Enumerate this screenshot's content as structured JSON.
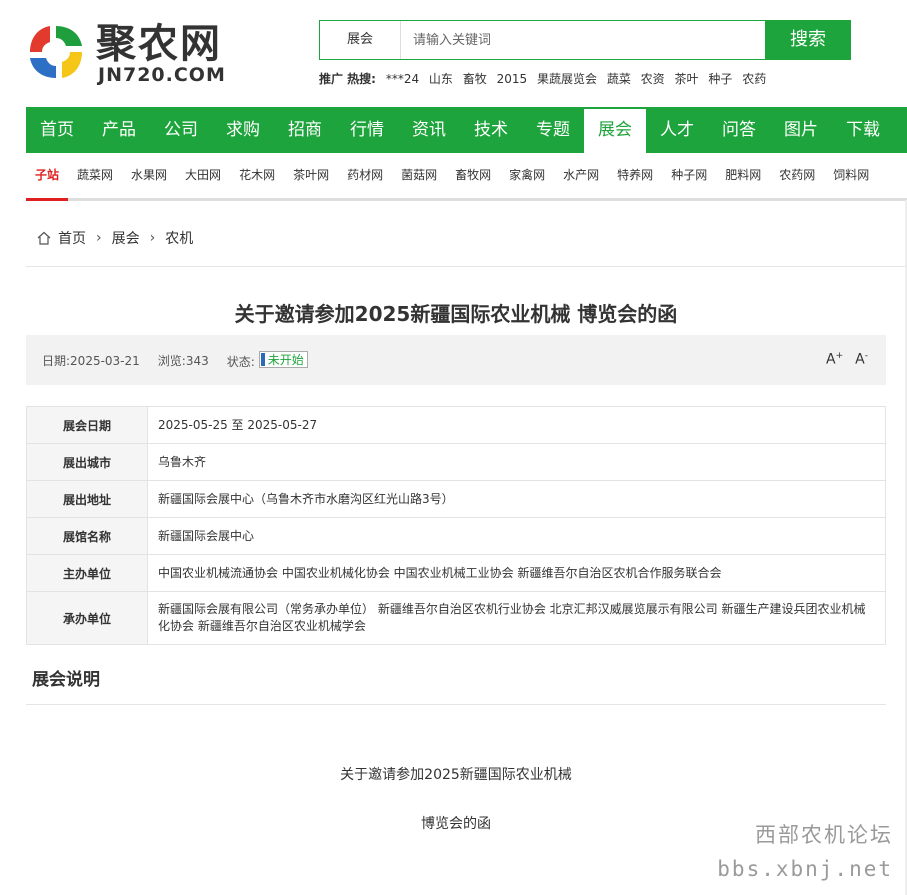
{
  "logo": {
    "name_cn": "聚农网",
    "name_en": "JN720.COM"
  },
  "search": {
    "category": "展会",
    "placeholder": "请输入关键词",
    "button": "搜索"
  },
  "hot": {
    "label": "推广 热搜:",
    "terms": [
      "***24",
      "山东",
      "畜牧",
      "2015",
      "果蔬展览会",
      "蔬菜",
      "农资",
      "茶叶",
      "种子",
      "农药"
    ]
  },
  "nav": {
    "items": [
      "首页",
      "产品",
      "公司",
      "求购",
      "招商",
      "行情",
      "资讯",
      "技术",
      "专题",
      "展会",
      "人才",
      "问答",
      "图片",
      "下载"
    ],
    "active": "展会"
  },
  "subnav": {
    "items": [
      "子站",
      "蔬菜网",
      "水果网",
      "大田网",
      "花木网",
      "茶叶网",
      "药材网",
      "菌菇网",
      "畜牧网",
      "家禽网",
      "水产网",
      "特养网",
      "种子网",
      "肥料网",
      "农药网",
      "饲料网"
    ],
    "active": "子站"
  },
  "breadcrumb": {
    "home": "首页",
    "level1": "展会",
    "level2": "农机"
  },
  "article": {
    "title": "关于邀请参加2025新疆国际农业机械 博览会的函",
    "date_label": "日期:",
    "date": "2025-03-21",
    "views_label": "浏览:",
    "views": "343",
    "status_label": "状态:",
    "status": "未开始",
    "font_up": "A",
    "font_down": "A",
    "font_up_sign": "+",
    "font_down_sign": "-"
  },
  "info_table": [
    {
      "key": "展会日期",
      "value": "2025-05-25 至 2025-05-27"
    },
    {
      "key": "展出城市",
      "value": "乌鲁木齐"
    },
    {
      "key": "展出地址",
      "value": "新疆国际会展中心（乌鲁木齐市水磨沟区红光山路3号）"
    },
    {
      "key": "展馆名称",
      "value": "新疆国际会展中心"
    },
    {
      "key": "主办单位",
      "value": "中国农业机械流通协会 中国农业机械化协会 中国农业机械工业协会 新疆维吾尔自治区农机合作服务联合会"
    },
    {
      "key": "承办单位",
      "value": "新疆国际会展有限公司（常务承办单位） 新疆维吾尔自治区农机行业协会 北京汇邦汉威展览展示有限公司 新疆生产建设兵团农业机械化协会 新疆维吾尔自治区农业机械学会"
    }
  ],
  "section": {
    "title": "展会说明"
  },
  "body": {
    "line1": "关于邀请参加2025新疆国际农业机械",
    "line2": "博览会的函"
  },
  "watermark": {
    "line1": "西部农机论坛",
    "line2": "bbs.xbnj.net"
  },
  "colors": {
    "brand_green": "#1ea43c",
    "active_red": "#e02020"
  }
}
